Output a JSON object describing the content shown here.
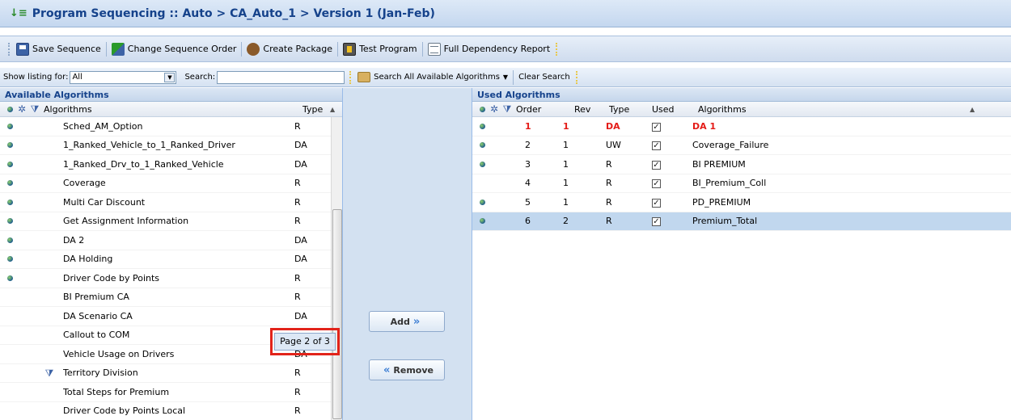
{
  "title": "Program Sequencing :: Auto > CA_Auto_1 > Version 1 (Jan-Feb)",
  "toolbar": {
    "save": "Save Sequence",
    "change_order": "Change Sequence Order",
    "create_package": "Create Package",
    "test_program": "Test Program",
    "full_dependency": "Full Dependency Report"
  },
  "filter": {
    "show_listing_label": "Show listing for:",
    "show_listing_value": "All",
    "search_label": "Search:",
    "search_value": "",
    "search_all": "Search All Available Algorithms",
    "clear_search": "Clear Search"
  },
  "available": {
    "title": "Available Algorithms",
    "headers": {
      "algorithms": "Algorithms",
      "type": "Type"
    },
    "rows": [
      {
        "name": "Sched_AM_Option",
        "type": "R",
        "dot": true
      },
      {
        "name": "1_Ranked_Vehicle_to_1_Ranked_Driver",
        "type": "DA",
        "dot": true
      },
      {
        "name": "1_Ranked_Drv_to_1_Ranked_Vehicle",
        "type": "DA",
        "dot": true
      },
      {
        "name": "Coverage",
        "type": "R",
        "dot": true
      },
      {
        "name": "Multi Car Discount",
        "type": "R",
        "dot": true
      },
      {
        "name": "Get Assignment Information",
        "type": "R",
        "dot": true
      },
      {
        "name": "DA 2",
        "type": "DA",
        "dot": true
      },
      {
        "name": "DA Holding",
        "type": "DA",
        "dot": true
      },
      {
        "name": "Driver Code by Points",
        "type": "R",
        "dot": true
      },
      {
        "name": "BI Premium CA",
        "type": "R",
        "dot": false
      },
      {
        "name": "DA Scenario CA",
        "type": "DA",
        "dot": false
      },
      {
        "name": "Callout to COM",
        "type": "",
        "dot": false
      },
      {
        "name": "Vehicle Usage on Drivers",
        "type": "DA",
        "dot": false
      },
      {
        "name": "Territory Division",
        "type": "R",
        "dot": false,
        "filter": true
      },
      {
        "name": "Total Steps for Premium",
        "type": "R",
        "dot": false
      },
      {
        "name": "Driver Code by Points Local",
        "type": "R",
        "dot": false
      }
    ],
    "page_tip": "Page 2 of 3"
  },
  "buttons": {
    "add": "Add",
    "remove": "Remove"
  },
  "used": {
    "title": "Used Algorithms",
    "headers": {
      "order": "Order",
      "rev": "Rev",
      "type": "Type",
      "used": "Used",
      "algorithms": "Algorithms"
    },
    "rows": [
      {
        "order": "1",
        "rev": "1",
        "type": "DA",
        "used": true,
        "name": "DA 1",
        "dot": true,
        "red": true
      },
      {
        "order": "2",
        "rev": "1",
        "type": "UW",
        "used": true,
        "name": "Coverage_Failure",
        "dot": true
      },
      {
        "order": "3",
        "rev": "1",
        "type": "R",
        "used": true,
        "name": "BI PREMIUM",
        "dot": true
      },
      {
        "order": "4",
        "rev": "1",
        "type": "R",
        "used": true,
        "name": "BI_Premium_Coll",
        "dot": false
      },
      {
        "order": "5",
        "rev": "1",
        "type": "R",
        "used": true,
        "name": "PD_PREMIUM",
        "dot": true
      },
      {
        "order": "6",
        "rev": "2",
        "type": "R",
        "used": true,
        "name": "Premium_Total",
        "dot": true,
        "selected": true
      }
    ]
  }
}
